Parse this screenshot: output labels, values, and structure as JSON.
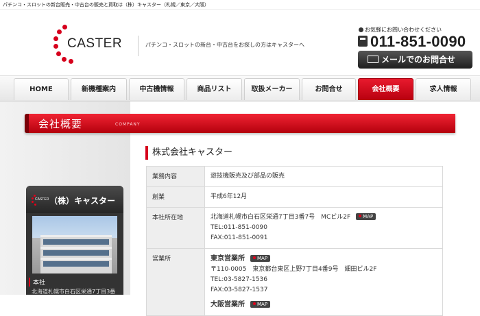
{
  "tagline": "パチンコ・スロットの新台販売・中古台の販売と買取は（株）キャスター（札幌／東京／大阪）",
  "brand": {
    "name": "CASTER",
    "description": "パチンコ・スロットの新台・中古台をお探しの方はキャスターへ",
    "accent_color": "#d6001c"
  },
  "contact": {
    "label": "お気軽にお問い合わせください",
    "phone": "011-851-0090",
    "mail_button": "メールでのお問合せ"
  },
  "nav": [
    {
      "label": "HOME"
    },
    {
      "label": "新機種案内"
    },
    {
      "label": "中古機情報"
    },
    {
      "label": "商品リスト"
    },
    {
      "label": "取扱メーカー"
    },
    {
      "label": "お問合せ"
    },
    {
      "label": "会社概要",
      "active": true
    },
    {
      "label": "求人情報"
    }
  ],
  "section": {
    "title": "会社概要",
    "subtitle": "COMPANY"
  },
  "sidebar": {
    "company": "（株）キャスター",
    "logo_text": "CASTER",
    "office_label": "本社",
    "address": "北海道札幌市白石区栄通7丁目3番"
  },
  "main": {
    "heading": "株式会社キャスター",
    "rows": {
      "business": {
        "label": "業務内容",
        "value": "遊技機販売及び部品の販売"
      },
      "founded": {
        "label": "創業",
        "value": "平成6年12月"
      },
      "hq": {
        "label": "本社所在地",
        "address": "北海道札幌市白石区栄通7丁目3番7号　MCビル2F",
        "tel": "TEL:011-851-0090",
        "fax": "FAX:011-851-0091"
      },
      "offices": {
        "label": "営業所",
        "tokyo_name": "東京営業所",
        "tokyo_address": "〒110-0005　東京都台東区上野7丁目4番9号　細田ビル2F",
        "tokyo_tel": "TEL:03-5827-1536",
        "tokyo_fax": "FAX:03-5827-1537",
        "osaka_name": "大阪営業所"
      }
    },
    "map_label": "MAP"
  }
}
